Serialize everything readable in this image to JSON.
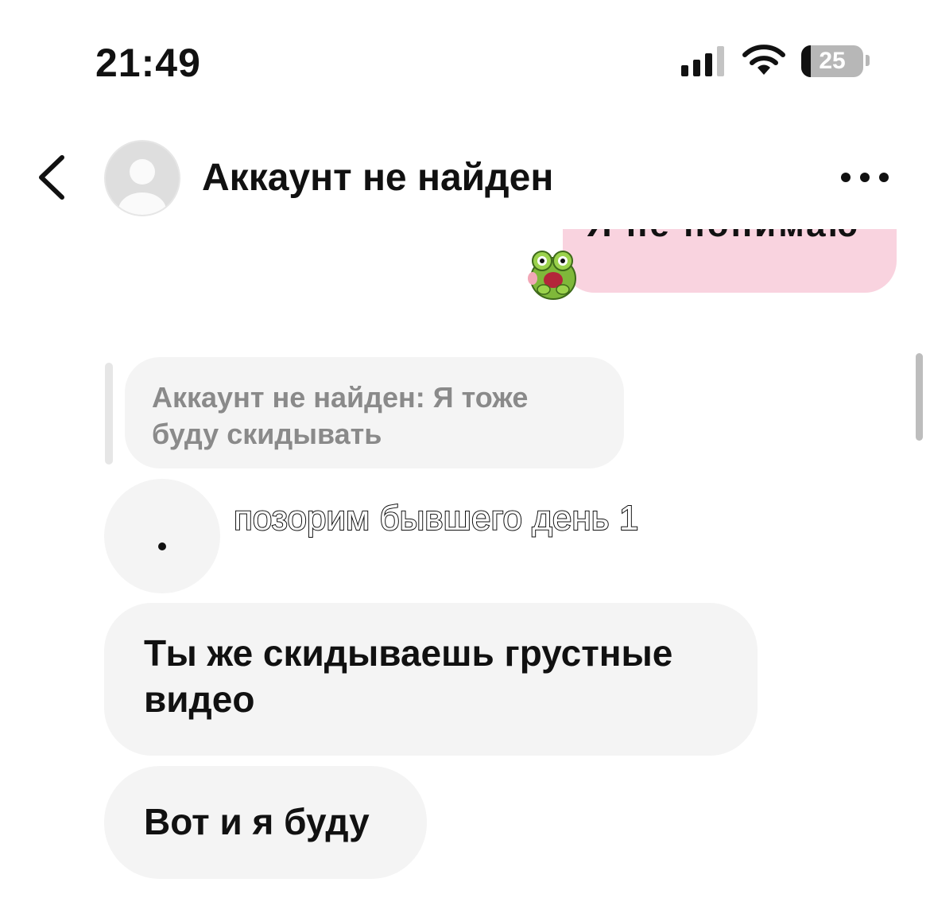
{
  "status_bar": {
    "time": "21:49",
    "battery": "25",
    "icons": [
      "signal-icon",
      "wifi-icon",
      "battery-icon"
    ]
  },
  "header": {
    "title": "Аккаунт не найден",
    "back_icon": "chevron-left-icon",
    "more_icon": "more-horizontal-icon"
  },
  "sent_message": {
    "text": "Я не понимаю",
    "sticker": "frog-sticker",
    "bubble_color": "#f9d3df"
  },
  "reply_quote": {
    "text": "Аккаунт не найден: Я тоже буду скидывать"
  },
  "shared_video": {
    "dot": "•",
    "caption": "позорим бывшего день 1"
  },
  "messages": [
    {
      "text": "Ты же скидываешь грустные видео"
    },
    {
      "text": "Вот и я буду"
    }
  ],
  "colors": {
    "received_bubble": "#f4f4f4",
    "quote_text": "#8a8a8a"
  }
}
